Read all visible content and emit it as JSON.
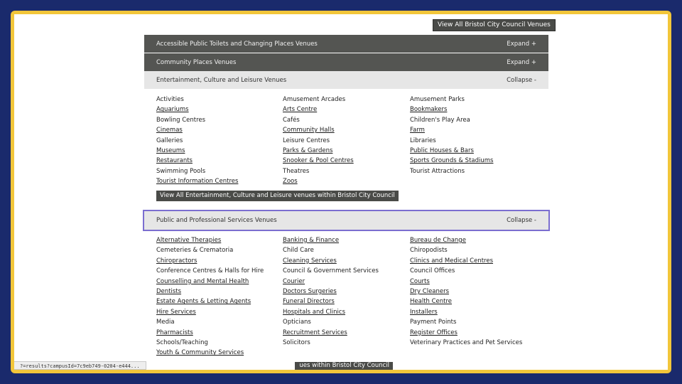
{
  "top_button": "View All Bristol City Council Venues",
  "sections": [
    {
      "title": "Accessible Public Toilets and Changing Places Venues",
      "action": "Expand +"
    },
    {
      "title": "Community Places Venues",
      "action": "Expand +"
    },
    {
      "title": "Entertainment, Culture and Leisure Venues",
      "action": "Collapse -"
    },
    {
      "title": "Public and Professional Services Venues",
      "action": "Collapse -"
    }
  ],
  "entertainment_items": [
    "Activities",
    "Amusement Arcades",
    "Amusement Parks",
    "Aquariums",
    "Arts Centre",
    "Bookmakers",
    "Bowling Centres",
    "Cafés",
    "Children's Play Area",
    "Cinemas",
    "Community Halls",
    "Farm",
    "Galleries",
    "Leisure Centres",
    "Libraries",
    "Museums",
    "Parks & Gardens",
    "Public Houses & Bars",
    "Restaurants",
    "Snooker & Pool Centres",
    "Sports Grounds & Stadiums",
    "Swimming Pools",
    "Theatres",
    "Tourist Attractions",
    "Tourist Information Centres",
    "Zoos",
    ""
  ],
  "entertainment_view_all": "View All Entertainment, Culture and Leisure venues within Bristol City Council",
  "services_items": [
    "Alternative Therapies",
    "Banking & Finance",
    "Bureau de Change",
    "Cemeteries & Crematoria",
    "Child Care",
    "Chiropodists",
    "Chiropractors",
    "Cleaning Services",
    "Clinics and Medical Centres",
    "Conference Centres & Halls for Hire",
    "Council & Government Services",
    "Council Offices",
    "Counselling and Mental Health",
    "Courier",
    "Courts",
    "Dentists",
    "Doctors Surgeries",
    "Dry Cleaners",
    "Estate Agents & Letting Agents",
    "Funeral Directors",
    "Health Centre",
    "Hire Services",
    "Hospitals and Clinics",
    "Installers",
    "Media",
    "Opticians",
    "Payment Points",
    "Pharmacists",
    "Recruitment Services",
    "Register Offices",
    "Schools/Teaching",
    "Solicitors",
    "Veterinary Practices and Pet Services",
    "Youth & Community Services",
    "",
    ""
  ],
  "services_view_all_partial": "ues within Bristol City Council",
  "status_bar": "?=results?campusId=7c9eb749-0204-e444..."
}
